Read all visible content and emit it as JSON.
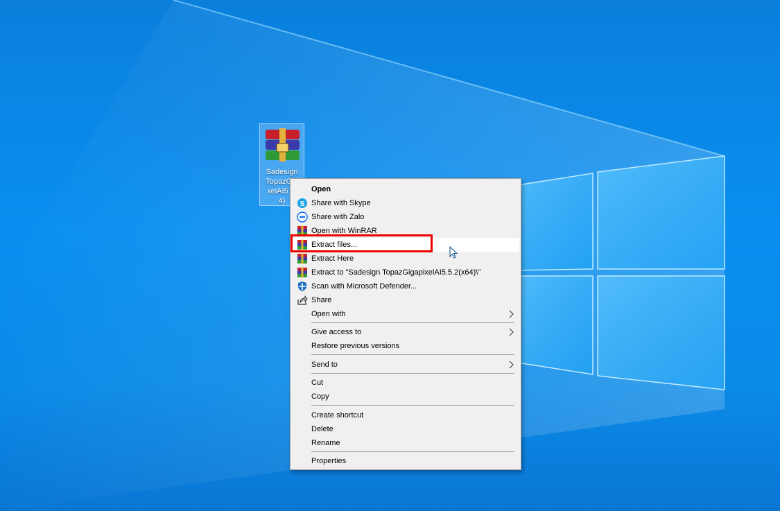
{
  "desktop": {
    "icon": {
      "name": "archive-file",
      "label": "Sadesign TopazGigapixelAI5.5.2(x64)",
      "label_visible_lines": [
        "Sadesign",
        "TopazGig",
        "xelAI5.5.",
        "4)"
      ]
    }
  },
  "context_menu": {
    "items": [
      {
        "label": "Open",
        "icon": "",
        "bold": true
      },
      {
        "label": "Share with Skype",
        "icon": "skype-icon"
      },
      {
        "label": "Share with Zalo",
        "icon": "zalo-icon"
      },
      {
        "label": "Open with WinRAR",
        "icon": "winrar-icon"
      },
      {
        "label": "Extract files...",
        "icon": "winrar-icon"
      },
      {
        "label": "Extract Here",
        "icon": "winrar-icon"
      },
      {
        "label": "Extract to \"Sadesign TopazGigapixelAI5.5.2(x64)\\\"",
        "icon": "winrar-icon"
      },
      {
        "label": "Scan with Microsoft Defender...",
        "icon": "defender-icon"
      },
      {
        "label": "Share",
        "icon": "share-icon"
      },
      {
        "label": "Open with",
        "icon": "",
        "submenu": true
      },
      {
        "label": "Give access to",
        "icon": "",
        "submenu": true
      },
      {
        "label": "Restore previous versions",
        "icon": ""
      },
      {
        "label": "Send to",
        "icon": "",
        "submenu": true
      },
      {
        "label": "Cut",
        "icon": ""
      },
      {
        "label": "Copy",
        "icon": ""
      },
      {
        "label": "Create shortcut",
        "icon": ""
      },
      {
        "label": "Delete",
        "icon": ""
      },
      {
        "label": "Rename",
        "icon": ""
      },
      {
        "label": "Properties",
        "icon": ""
      }
    ],
    "hovered_item": "Extract files..."
  },
  "annotation": {
    "highlight_color": "#ee0000",
    "highlighted_item": "Extract files..."
  },
  "colors": {
    "desktop_blue": "#0a8ff0",
    "menu_bg": "#f0f0f0",
    "hover_bg": "#ffffff"
  }
}
